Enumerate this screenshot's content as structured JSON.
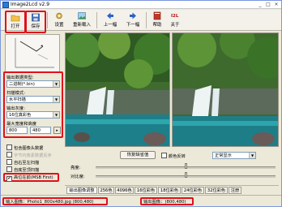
{
  "window": {
    "title": "Image2Lcd v2.9",
    "minimize": "_",
    "maximize": "□",
    "close": "×"
  },
  "toolbar": {
    "open": "打开",
    "save": "保存",
    "settings": "设置",
    "reload": "重新载入",
    "prev": "上一幅",
    "next": "下一幅",
    "help": "帮助",
    "about": "关于"
  },
  "left_panel": {
    "output_type_label": "输出数据类型:",
    "output_type_value": "二进制(*.bin)",
    "scan_mode_label": "扫描模式:",
    "scan_mode_value": "水平扫描",
    "gray_label": "输出灰度:",
    "gray_value": "16位真彩色",
    "max_size_label": "最大宽度和高度",
    "max_width": "800",
    "max_height": "480",
    "arrow_button": "▸",
    "opt_include_header": "包含图像头数据",
    "opt_scan_right_left": "字节内像素数据反序",
    "opt_scan_bottom_top": "自右至左扫描",
    "opt_scan_down_up": "自底至顶扫描",
    "opt_high_first": "高位在前(MSB First)",
    "opt_high_first_checked": "✔"
  },
  "controls": {
    "restore_default": "恢复缺省值",
    "color_invert": "颜色反转",
    "display_mode": "正常显示",
    "brightness_label": "亮度:",
    "contrast_label": "对比度:",
    "brightness": 0.5,
    "contrast": 0.5
  },
  "tabs": [
    "输出图像调整",
    "256色",
    "4096色",
    "16位彩色",
    "18位彩色",
    "24位彩色",
    "32位彩色",
    "注册"
  ],
  "status": {
    "input": "输入图像：Photo1_800x480.jpg (800,480)",
    "output": "输出图像：(800,480)"
  },
  "colors": {
    "highlight": "#e0101a",
    "window_bg": "#ece9d8"
  }
}
